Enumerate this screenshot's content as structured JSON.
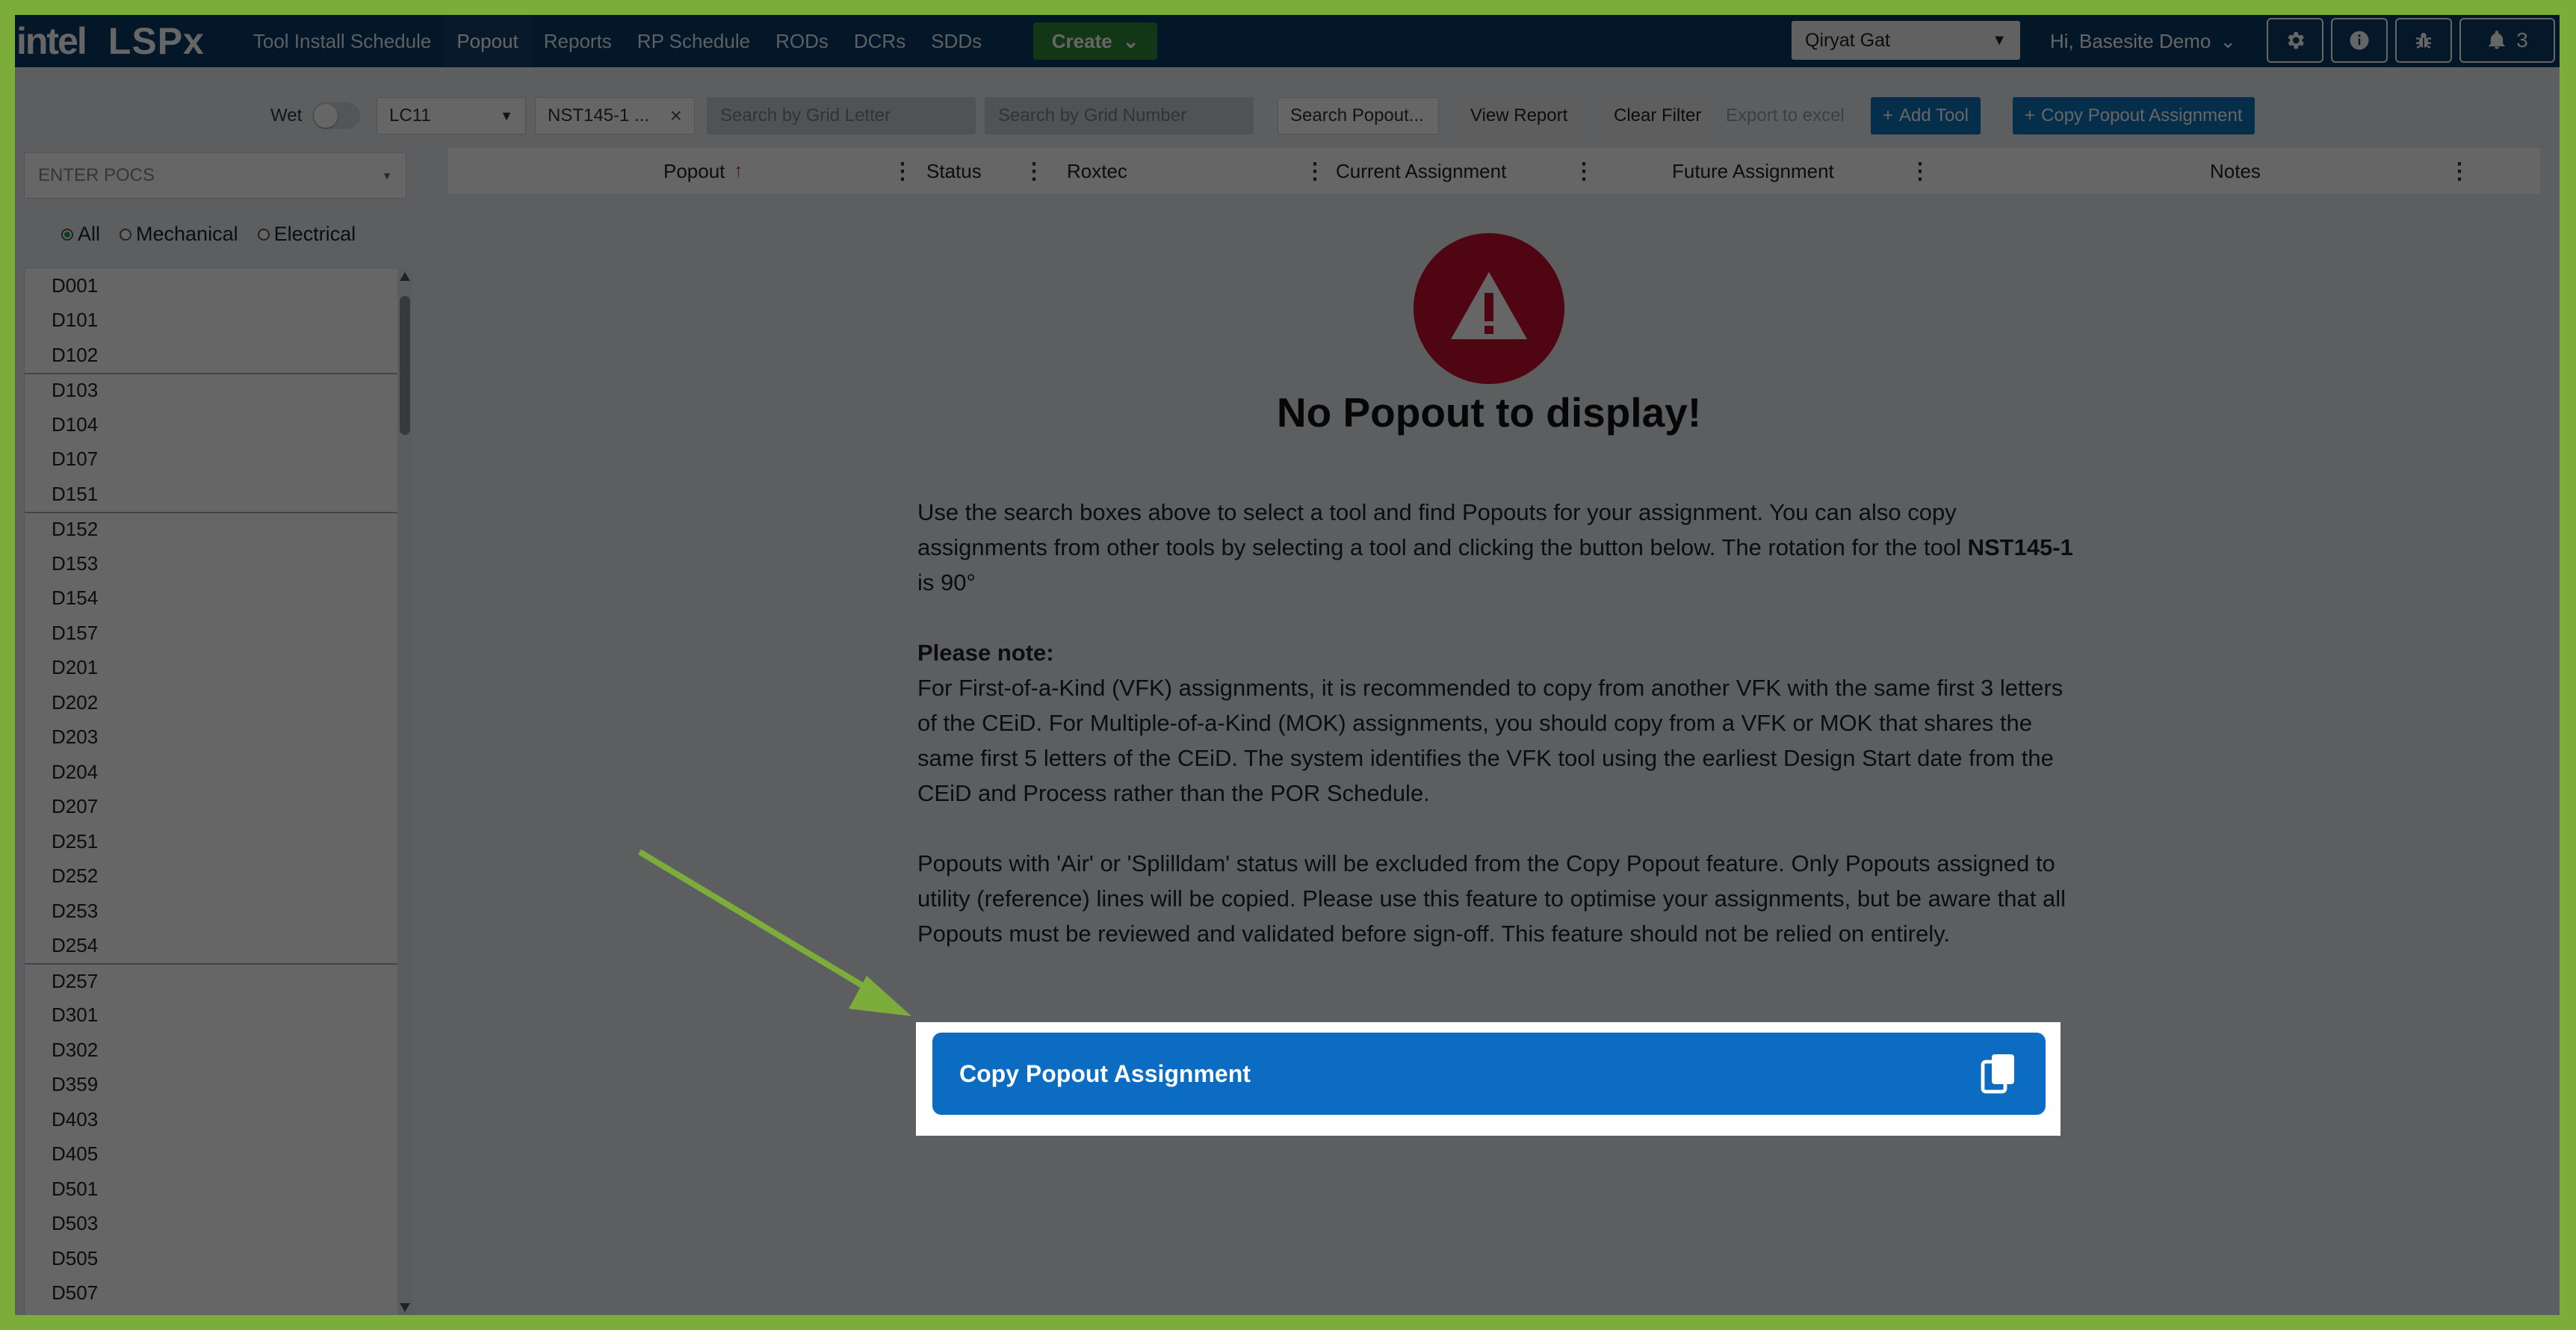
{
  "app": {
    "brand": "intel",
    "product": "LSPx"
  },
  "nav": {
    "links": [
      "Tool Install Schedule",
      "Popout",
      "Reports",
      "RP Schedule",
      "RODs",
      "DCRs",
      "SDDs"
    ],
    "active": "Popout",
    "create_label": "Create",
    "site": "Qiryat Gat",
    "greeting": "Hi, Basesite Demo",
    "notification_count": "3"
  },
  "filters": {
    "wet_label": "Wet",
    "wet_on": false,
    "lc_value": "LC11",
    "tool_value": "NST145-1 ...",
    "grid_letter_placeholder": "Search by Grid Letter",
    "grid_number_placeholder": "Search by Grid Number",
    "search_popout_placeholder": "Search Popout...",
    "view_report": "View Report",
    "clear_filter": "Clear Filter",
    "export": "Export to excel",
    "add_tool": "Add Tool",
    "copy_assignment": "Copy Popout Assignment"
  },
  "left": {
    "pocs_placeholder": "ENTER POCS",
    "radio_options": [
      "All",
      "Mechanical",
      "Electrical"
    ],
    "radio_selected": "All",
    "pocs": [
      "D001",
      "D101",
      "D102",
      "D103",
      "D104",
      "D107",
      "D151",
      "D152",
      "D153",
      "D154",
      "D157",
      "D201",
      "D202",
      "D203",
      "D204",
      "D207",
      "D251",
      "D252",
      "D253",
      "D254",
      "D257",
      "D301",
      "D302",
      "D359",
      "D403",
      "D405",
      "D501",
      "D503",
      "D505",
      "D507"
    ]
  },
  "table": {
    "columns": [
      "Popout",
      "Status",
      "Roxtec",
      "Current Assignment",
      "Future Assignment",
      "Notes"
    ],
    "sorted_column": "Popout"
  },
  "empty_state": {
    "title": "No Popout to display!",
    "intro_1": "Use the search boxes above to select a tool and find Popouts for your assignment. You can also copy assignments from other tools by selecting a tool and clicking the button below. The rotation for the tool ",
    "tool_name": "NST145-1",
    "intro_2": " is 90°",
    "note_heading": "Please note:",
    "note_body": "For First-of-a-Kind (VFK) assignments, it is recommended to copy from another VFK with the same first 3 letters of the CEiD. For Multiple-of-a-Kind (MOK) assignments, you should copy from a VFK or MOK that shares the same first 5 letters of the CEiD. The system identifies the VFK tool using the earliest Design Start date from the CEiD and Process rather than the POR Schedule.",
    "exclusion": "Popouts with 'Air' or 'Splilldam' status will be excluded from the Copy Popout feature. Only Popouts assigned to utility (reference) lines will be copied. Please use this feature to optimise your assignments, but be aware that all Popouts must be reviewed and validated before sign-off. This feature should not be relied on entirely.",
    "copy_button": "Copy Popout Assignment"
  },
  "icons": {
    "settings": "gear-icon",
    "info": "info-icon",
    "bug": "bug-icon",
    "bell": "bell-icon",
    "copy": "copy-icon",
    "warning": "warning-icon"
  },
  "colors": {
    "nav_bg": "#0b3a64",
    "accent_blue": "#0b6cc1",
    "warning_red": "#c8102e",
    "frame_green": "#7cad3a",
    "create_green": "#2f8a3a"
  }
}
